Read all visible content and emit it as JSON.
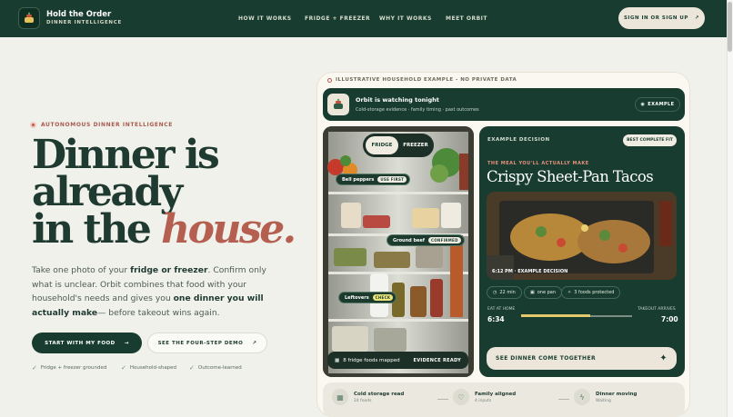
{
  "header": {
    "title": "Hold the Order",
    "subtitle": "DINNER INTELLIGENCE",
    "nav": [
      "HOW IT WORKS",
      "FRIDGE + FREEZER",
      "WHY IT WORKS",
      "MEET ORBIT"
    ],
    "signin": "SIGN IN OR SIGN UP"
  },
  "hero": {
    "kicker": "AUTONOMOUS DINNER INTELLIGENCE",
    "headline": {
      "l1": "Dinner is",
      "l2": "already",
      "l3a": "in the ",
      "l3b": "house."
    },
    "lede": {
      "p1": "Take one photo of your ",
      "b1": "fridge or freezer",
      "p2": ". Confirm only what is unclear. Orbit combines that food with your household's needs and gives you ",
      "b2": "one dinner you will actually make",
      "p3": "— before takeout wins again."
    },
    "cta_primary": "START WITH MY FOOD",
    "cta_secondary": "SEE THE FOUR-STEP DEMO",
    "checks": [
      "Fridge + freezer grounded",
      "Household-shaped",
      "Outcome-learned"
    ]
  },
  "demo": {
    "label": "ILLUSTRATIVE HOUSEHOLD EXAMPLE - NO PRIVATE DATA",
    "orbit": {
      "title": "Orbit is watching tonight",
      "sub": "Cold-storage evidence · family timing · past outcomes",
      "badge": "EXAMPLE"
    },
    "fridge": {
      "tab_active": "FRIDGE",
      "tab_other": "FREEZER",
      "tags": [
        {
          "name": "Bell peppers",
          "badge": "USE FIRST"
        },
        {
          "name": "Ground beef",
          "badge": "CONFIRMED"
        },
        {
          "name": "Leftovers",
          "badge": "CHECK"
        }
      ],
      "foods_mapped": "8 fridge foods mapped",
      "evidence": "EVIDENCE READY"
    },
    "decision": {
      "label": "EXAMPLE DECISION",
      "badge": "BEST COMPLETE FIT",
      "meal_label": "THE MEAL YOU'LL ACTUALLY MAKE",
      "meal": "Crispy Sheet-Pan Tacos",
      "photo_caption": "6:12 PM · EXAMPLE DECISION",
      "meta": [
        "22 min",
        "one pan",
        "3 foods protected"
      ],
      "eat_label": "EAT AT HOME",
      "eat_time": "6:34",
      "takeout_label": "TAKEOUT ARRIVES",
      "takeout_time": "7:00",
      "progress": 0.62,
      "cta": "SEE DINNER COME TOGETHER"
    },
    "steps": [
      {
        "title": "Cold storage read",
        "sub": "24 foods"
      },
      {
        "title": "Family aligned",
        "sub": "4 inputs"
      },
      {
        "title": "Dinner moving",
        "sub": "Waiting"
      }
    ]
  },
  "colors": {
    "brand": "#183d30",
    "accent": "#b55f51",
    "highlight": "#e4c96d"
  }
}
